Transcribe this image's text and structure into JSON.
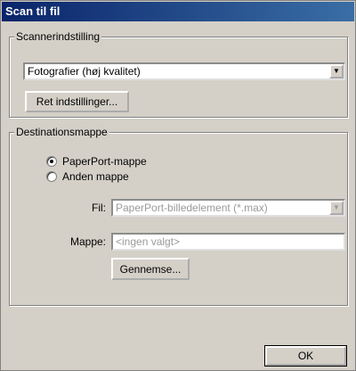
{
  "window": {
    "title": "Scan til fil"
  },
  "scanner_group": {
    "legend": "Scannerindstilling",
    "quality_select": {
      "value": "Fotografier (høj kvalitet)"
    },
    "settings_button": "Ret indstillinger..."
  },
  "destination_group": {
    "legend": "Destinationsmappe",
    "radios": [
      {
        "label": "PaperPort-mappe",
        "selected": true
      },
      {
        "label": "Anden mappe",
        "selected": false
      }
    ],
    "file_label": "Fil:",
    "file_select": {
      "value": "PaperPort-billedelement (*.max)"
    },
    "folder_label": "Mappe:",
    "folder_input": {
      "value": "<ingen valgt>"
    },
    "browse_button": "Gennemse..."
  },
  "ok_button": "OK"
}
